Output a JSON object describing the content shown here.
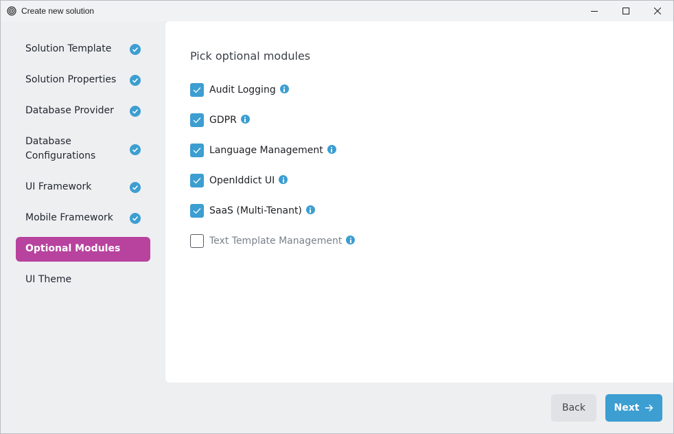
{
  "window": {
    "title": "Create new solution",
    "icon": "fingerprint-icon",
    "controls": [
      "minimize-icon",
      "maximize-icon",
      "close-icon"
    ]
  },
  "sidebar": {
    "items": [
      {
        "label": "Solution Template",
        "completed": true,
        "active": false
      },
      {
        "label": "Solution Properties",
        "completed": true,
        "active": false
      },
      {
        "label": "Database Provider",
        "completed": true,
        "active": false
      },
      {
        "label": "Database Configurations",
        "completed": true,
        "active": false
      },
      {
        "label": "UI Framework",
        "completed": true,
        "active": false
      },
      {
        "label": "Mobile Framework",
        "completed": true,
        "active": false
      },
      {
        "label": "Optional Modules",
        "completed": false,
        "active": true
      },
      {
        "label": "UI Theme",
        "completed": false,
        "active": false
      }
    ]
  },
  "main": {
    "heading": "Pick optional modules",
    "modules": [
      {
        "label": "Audit Logging",
        "checked": true
      },
      {
        "label": "GDPR",
        "checked": true
      },
      {
        "label": "Language Management",
        "checked": true
      },
      {
        "label": "OpenIddict UI",
        "checked": true
      },
      {
        "label": "SaaS (Multi-Tenant)",
        "checked": true
      },
      {
        "label": "Text Template Management",
        "checked": false
      }
    ]
  },
  "footer": {
    "back_label": "Back",
    "next_label": "Next"
  },
  "colors": {
    "accent": "#3c9ed1",
    "active_nav": "#b8439e",
    "background": "#eeeff1",
    "panel": "#ffffff"
  }
}
